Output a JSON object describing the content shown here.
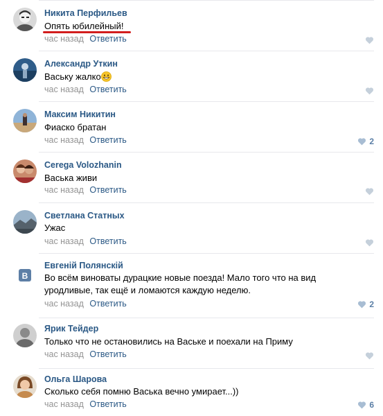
{
  "comments": [
    {
      "author": "Никита Перфильев",
      "text": "Опять юбилейный!",
      "time": "час назад",
      "reply_label": "Ответить",
      "likes": "",
      "avatar": "user-photo-grayscale"
    },
    {
      "author": "Александр Уткин",
      "text": "Ваську жалко",
      "emoji": "grinning-face-emoji",
      "time": "час назад",
      "reply_label": "Ответить",
      "likes": "",
      "avatar": "user-photo-blue"
    },
    {
      "author": "Максим Никитин",
      "text": "Фиаско братан",
      "time": "час назад",
      "reply_label": "Ответить",
      "likes": "2",
      "avatar": "user-photo-beach"
    },
    {
      "author": "Cerega Volozhanin",
      "text": "Васька живи",
      "time": "час назад",
      "reply_label": "Ответить",
      "likes": "",
      "avatar": "user-photo-couple"
    },
    {
      "author": "Светлана Статных",
      "text": "Ужас",
      "time": "час назад",
      "reply_label": "Ответить",
      "likes": "",
      "avatar": "user-photo-landscape"
    },
    {
      "author": "Евгеній Полянскій",
      "text": "Во всём виноваты дурацкие новые поезда! Мало того что на вид уродливые, так ещё и ломаются каждую неделю.",
      "time": "час назад",
      "reply_label": "Ответить",
      "likes": "2",
      "avatar": "vk-logo-default"
    },
    {
      "author": "Ярик Тейдер",
      "text": "Только что не остановились на Ваське и поехали на Приму",
      "time": "час назад",
      "reply_label": "Ответить",
      "likes": "",
      "avatar": "user-photo-gray"
    },
    {
      "author": "Ольга Шарова",
      "text": "Сколько себя помню Васька вечно умирает...))",
      "time": "час назад",
      "reply_label": "Ответить",
      "likes": "6",
      "avatar": "user-photo-woman"
    }
  ],
  "colors": {
    "link": "#2a5885",
    "muted": "#939393",
    "like_count": "#5b7fa6",
    "heart_inactive": "#c5d0db",
    "heart_counted": "#a8bdd3",
    "underline_mark": "#d21d1d",
    "separator": "#e7e8ec"
  }
}
